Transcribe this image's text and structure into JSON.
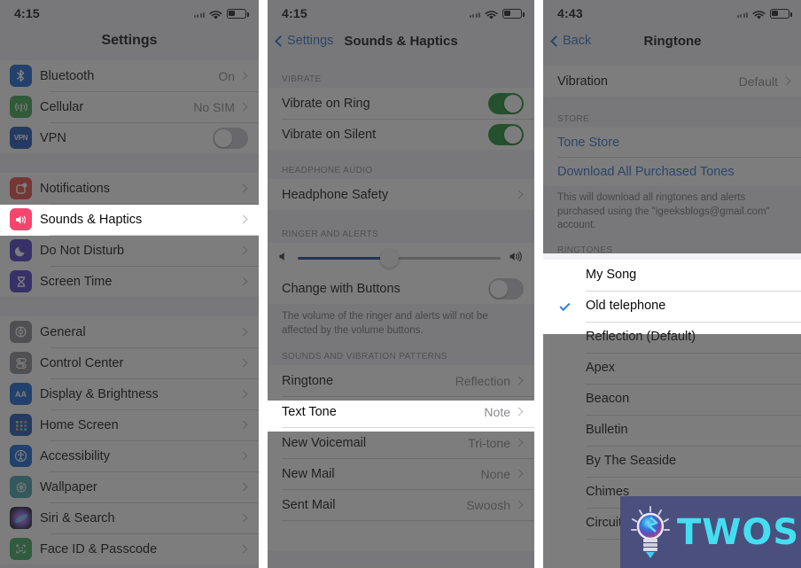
{
  "panel1": {
    "status": {
      "time": "4:15",
      "wifi_icon": "wifi-icon",
      "battery_icon": "battery-icon",
      "signal_icon": "signal-dots-icon"
    },
    "nav": {
      "title": "Settings"
    },
    "groups": [
      {
        "rows": [
          {
            "label": "Bluetooth",
            "value": "On",
            "icon": "bluetooth-icon",
            "icon_color": "#1263d1",
            "accessory": "chevron"
          },
          {
            "label": "Cellular",
            "value": "No SIM",
            "icon": "cellular-icon",
            "icon_color": "#35a24a",
            "accessory": "chevron"
          },
          {
            "label": "VPN",
            "value": "",
            "icon": "vpn-icon",
            "icon_color": "#1650b5",
            "accessory": "toggle-off"
          }
        ]
      },
      {
        "rows": [
          {
            "label": "Notifications",
            "value": "",
            "icon": "notifications-icon",
            "icon_color": "#e8483f",
            "accessory": "chevron"
          },
          {
            "label": "Sounds & Haptics",
            "value": "",
            "icon": "sounds-haptics-icon",
            "icon_color": "#f7456e",
            "accessory": "chevron",
            "highlighted": true
          },
          {
            "label": "Do Not Disturb",
            "value": "",
            "icon": "do-not-disturb-icon",
            "icon_color": "#4b38c9",
            "accessory": "chevron"
          },
          {
            "label": "Screen Time",
            "value": "",
            "icon": "screen-time-icon",
            "icon_color": "#4b38c9",
            "accessory": "chevron"
          }
        ]
      },
      {
        "rows": [
          {
            "label": "General",
            "value": "",
            "icon": "general-gear-icon",
            "icon_color": "#8a8a8e",
            "accessory": "chevron"
          },
          {
            "label": "Control Center",
            "value": "",
            "icon": "control-center-icon",
            "icon_color": "#8a8a8e",
            "accessory": "chevron"
          },
          {
            "label": "Display & Brightness",
            "value": "",
            "icon": "display-brightness-icon",
            "icon_color": "#1263d1",
            "accessory": "chevron"
          },
          {
            "label": "Home Screen",
            "value": "",
            "icon": "home-screen-icon",
            "icon_color": "#1650b5",
            "accessory": "chevron"
          },
          {
            "label": "Accessibility",
            "value": "",
            "icon": "accessibility-icon",
            "icon_color": "#1263d1",
            "accessory": "chevron"
          },
          {
            "label": "Wallpaper",
            "value": "",
            "icon": "wallpaper-icon",
            "icon_color": "#3f9ea6",
            "accessory": "chevron"
          },
          {
            "label": "Siri & Search",
            "value": "",
            "icon": "siri-search-icon",
            "icon_color": "#2b2b44",
            "accessory": "chevron"
          },
          {
            "label": "Face ID & Passcode",
            "value": "",
            "icon": "face-id-icon",
            "icon_color": "#36a65a",
            "accessory": "chevron"
          }
        ]
      }
    ]
  },
  "panel2": {
    "status": {
      "time": "4:15"
    },
    "nav": {
      "back_label": "Settings",
      "title": "Sounds & Haptics"
    },
    "vibrate_header": "VIBRATE",
    "vibrate_rows": [
      {
        "label": "Vibrate on Ring",
        "toggle": "on"
      },
      {
        "label": "Vibrate on Silent",
        "toggle": "on"
      }
    ],
    "headphone_header": "HEADPHONE AUDIO",
    "headphone_rows": [
      {
        "label": "Headphone Safety",
        "accessory": "chevron"
      }
    ],
    "ringer_header": "RINGER AND ALERTS",
    "slider": {
      "value_percent": 45,
      "min_icon": "speaker-low-icon",
      "max_icon": "speaker-high-icon"
    },
    "change_with_buttons": {
      "label": "Change with Buttons",
      "toggle": "off"
    },
    "footnote": "The volume of the ringer and alerts will not be affected by the volume buttons.",
    "patterns_header": "SOUNDS AND VIBRATION PATTERNS",
    "pattern_rows": [
      {
        "label": "Ringtone",
        "value": "Reflection",
        "highlighted": true
      },
      {
        "label": "Text Tone",
        "value": "Note"
      },
      {
        "label": "New Voicemail",
        "value": "Tri-tone"
      },
      {
        "label": "New Mail",
        "value": "None"
      },
      {
        "label": "Sent Mail",
        "value": "Swoosh"
      }
    ]
  },
  "panel3": {
    "status": {
      "time": "4:43"
    },
    "nav": {
      "back_label": "Back",
      "title": "Ringtone"
    },
    "vibration_row": {
      "label": "Vibration",
      "value": "Default"
    },
    "store_header": "STORE",
    "store_links": [
      {
        "label": "Tone Store"
      },
      {
        "label": "Download All Purchased Tones"
      }
    ],
    "store_footnote": "This will download all ringtones and alerts purchased using the \"igeeksblogs@gmail.com\" account.",
    "ringtones_header": "RINGTONES",
    "ringtones": [
      {
        "label": "My Song",
        "selected": false,
        "highlighted": true
      },
      {
        "label": "Old telephone",
        "selected": true,
        "highlighted": true
      },
      {
        "label": "Reflection (Default)",
        "selected": false
      },
      {
        "label": "Apex",
        "selected": false
      },
      {
        "label": "Beacon",
        "selected": false
      },
      {
        "label": "Bulletin",
        "selected": false
      },
      {
        "label": "By The Seaside",
        "selected": false
      },
      {
        "label": "Chimes",
        "selected": false
      },
      {
        "label": "Circuit",
        "selected": false
      }
    ]
  },
  "watermark": {
    "text": "TWOS",
    "icon": "lightbulb-icon",
    "bg_color": "#4b4f7e",
    "text_color": "#43dff0"
  }
}
